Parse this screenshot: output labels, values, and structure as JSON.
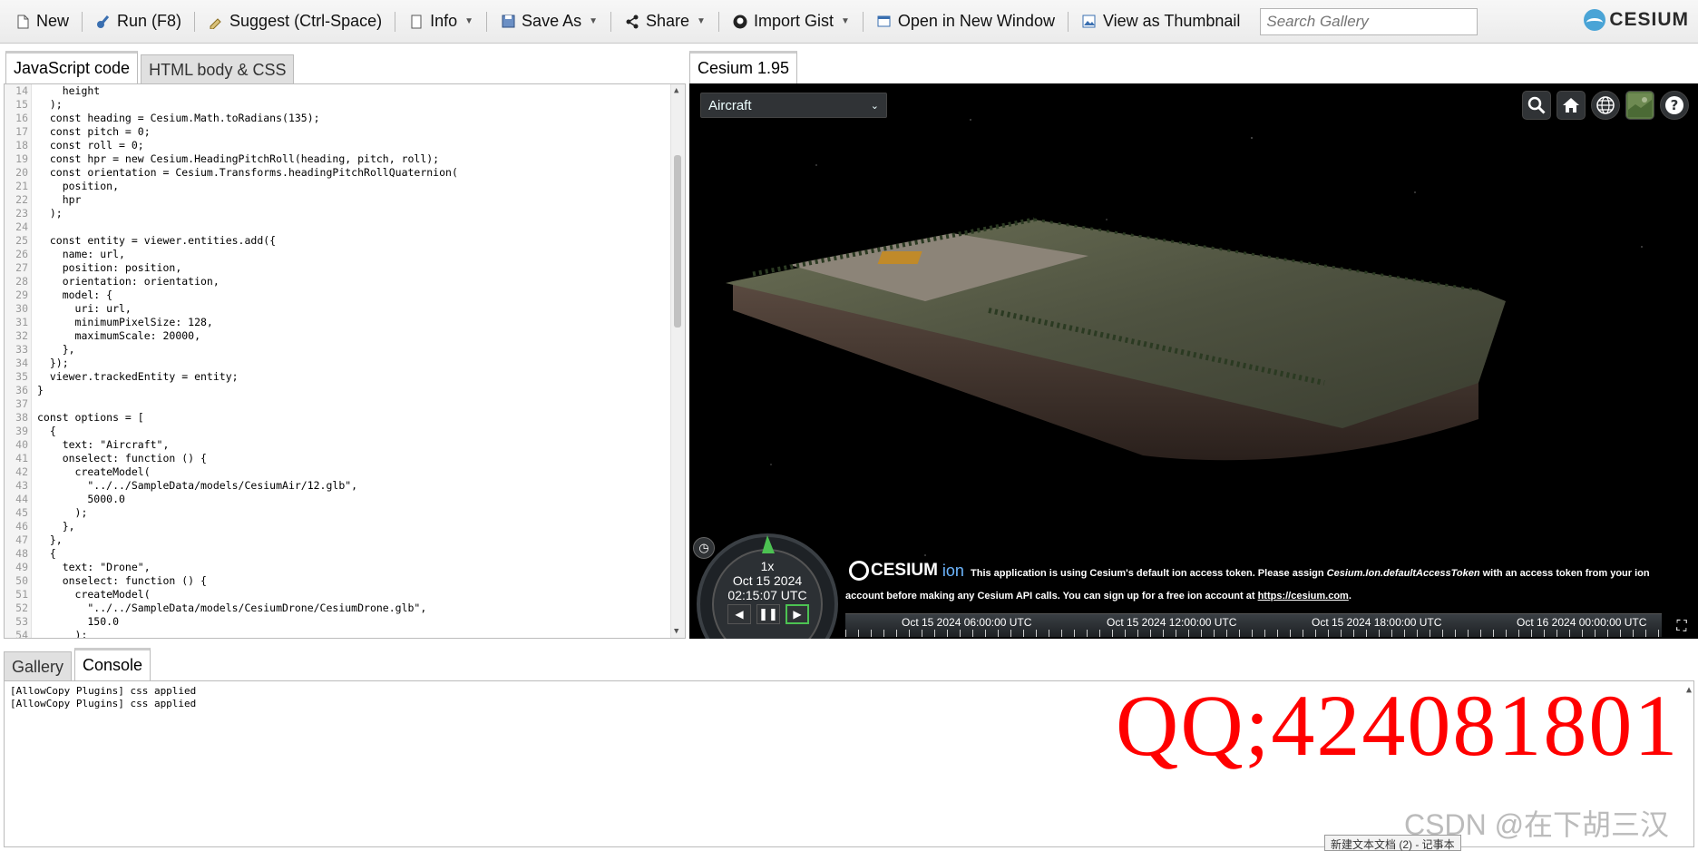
{
  "toolbar": {
    "new_label": "New",
    "run_label": "Run (F8)",
    "suggest_label": "Suggest (Ctrl-Space)",
    "info_label": "Info",
    "save_as_label": "Save As",
    "share_label": "Share",
    "import_gist_label": "Import Gist",
    "open_new_window_label": "Open in New Window",
    "view_thumbnail_label": "View as Thumbnail",
    "search_placeholder": "Search Gallery",
    "brand": "CESIUM"
  },
  "editor": {
    "tabs": [
      {
        "label": "JavaScript code",
        "active": true
      },
      {
        "label": "HTML body & CSS",
        "active": false
      }
    ],
    "lines": [
      {
        "n": "14",
        "text": "    height"
      },
      {
        "n": "15",
        "text": "  );"
      },
      {
        "n": "16",
        "text": "  const heading = Cesium.Math.toRadians(135);"
      },
      {
        "n": "17",
        "text": "  const pitch = 0;"
      },
      {
        "n": "18",
        "text": "  const roll = 0;"
      },
      {
        "n": "19",
        "text": "  const hpr = new Cesium.HeadingPitchRoll(heading, pitch, roll);"
      },
      {
        "n": "20",
        "text": "  const orientation = Cesium.Transforms.headingPitchRollQuaternion("
      },
      {
        "n": "21",
        "text": "    position,"
      },
      {
        "n": "22",
        "text": "    hpr"
      },
      {
        "n": "23",
        "text": "  );"
      },
      {
        "n": "24",
        "text": ""
      },
      {
        "n": "25",
        "text": "  const entity = viewer.entities.add({"
      },
      {
        "n": "26",
        "text": "    name: url,"
      },
      {
        "n": "27",
        "text": "    position: position,"
      },
      {
        "n": "28",
        "text": "    orientation: orientation,"
      },
      {
        "n": "29",
        "text": "    model: {"
      },
      {
        "n": "30",
        "text": "      uri: url,"
      },
      {
        "n": "31",
        "text": "      minimumPixelSize: 128,"
      },
      {
        "n": "32",
        "text": "      maximumScale: 20000,"
      },
      {
        "n": "33",
        "text": "    },"
      },
      {
        "n": "34",
        "text": "  });"
      },
      {
        "n": "35",
        "text": "  viewer.trackedEntity = entity;"
      },
      {
        "n": "36",
        "text": "}"
      },
      {
        "n": "37",
        "text": ""
      },
      {
        "n": "38",
        "text": "const options = ["
      },
      {
        "n": "39",
        "text": "  {"
      },
      {
        "n": "40",
        "text": "    text: \"Aircraft\","
      },
      {
        "n": "41",
        "text": "    onselect: function () {"
      },
      {
        "n": "42",
        "text": "      createModel("
      },
      {
        "n": "43",
        "text": "        \"../../SampleData/models/CesiumAir/12.glb\","
      },
      {
        "n": "44",
        "text": "        5000.0"
      },
      {
        "n": "45",
        "text": "      );"
      },
      {
        "n": "46",
        "text": "    },"
      },
      {
        "n": "47",
        "text": "  },"
      },
      {
        "n": "48",
        "text": "  {"
      },
      {
        "n": "49",
        "text": "    text: \"Drone\","
      },
      {
        "n": "50",
        "text": "    onselect: function () {"
      },
      {
        "n": "51",
        "text": "      createModel("
      },
      {
        "n": "52",
        "text": "        \"../../SampleData/models/CesiumDrone/CesiumDrone.glb\","
      },
      {
        "n": "53",
        "text": "        150.0"
      },
      {
        "n": "54",
        "text": "      );"
      }
    ]
  },
  "viewer": {
    "tab_label": "Cesium 1.95",
    "model_select_value": "Aircraft",
    "speed": "1x",
    "date": "Oct 15 2024",
    "time": "02:15:07 UTC",
    "ion_logo": "CESIUM",
    "ion_suffix": "ion",
    "credit_part1": "This application is using Cesium's default ion access token. Please assign ",
    "credit_code": "Cesium.Ion.defaultAccessToken",
    "credit_part2": " with an access token from your ion account before making any Cesium API calls. You can sign up for a free ion account at ",
    "credit_link": "https://cesium.com",
    "credit_end": ".",
    "timeline_labels": [
      "Oct 15 2024 06:00:00 UTC",
      "Oct 15 2024 12:00:00 UTC",
      "Oct 15 2024 18:00:00 UTC",
      "Oct 16 2024 00:00:00 UTC"
    ]
  },
  "bottom": {
    "tabs": [
      {
        "label": "Gallery",
        "active": false
      },
      {
        "label": "Console",
        "active": true
      }
    ],
    "console_lines": [
      "[AllowCopy Plugins] css applied",
      "[AllowCopy Plugins] css applied"
    ]
  },
  "overlay": {
    "qq_text": "QQ;424081801",
    "csdn_text": "CSDN @在下胡三汉",
    "taskbar_tip": "新建文本文档 (2) - 记事本"
  },
  "colors": {
    "qq_watermark": "#ff0000",
    "ion_accent": "#6db6ff",
    "viewer_bg": "#000000"
  }
}
